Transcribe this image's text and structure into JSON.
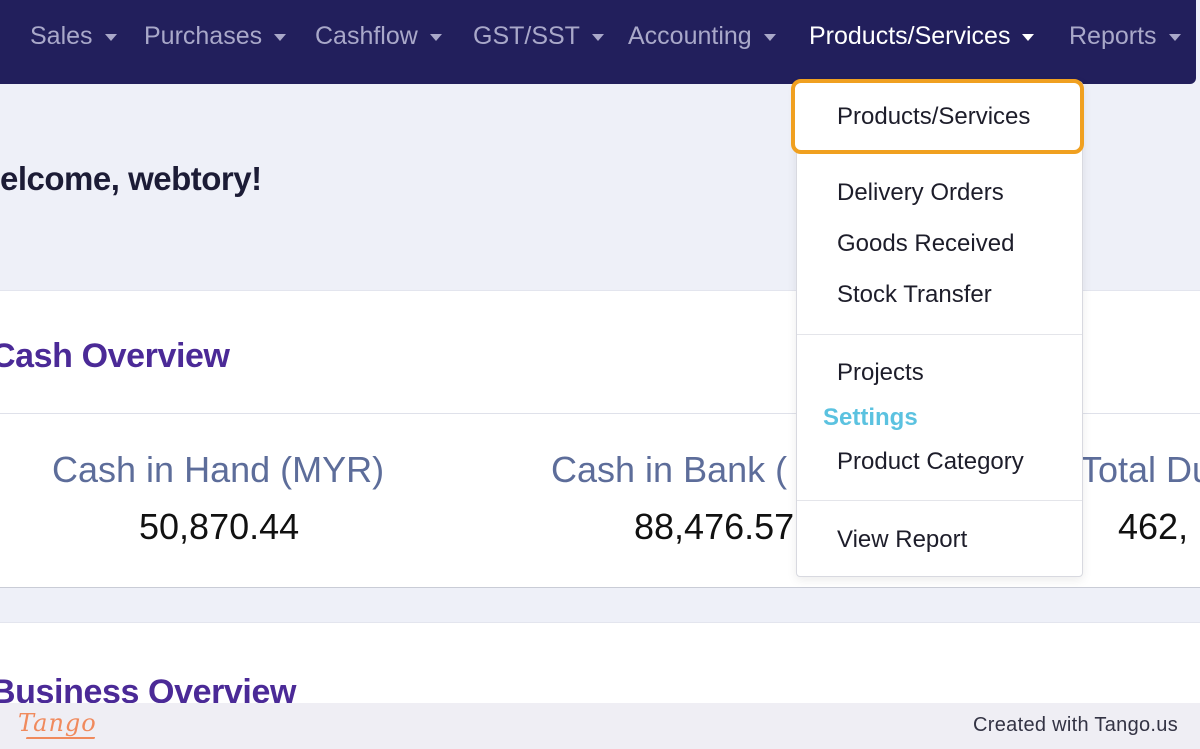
{
  "nav": {
    "items": [
      {
        "label": "Sales"
      },
      {
        "label": "Purchases"
      },
      {
        "label": "Cashflow"
      },
      {
        "label": "GST/SST"
      },
      {
        "label": "Accounting"
      },
      {
        "label": "Products/Services"
      },
      {
        "label": "Reports"
      }
    ],
    "active": "Products/Services"
  },
  "welcome": {
    "text": "elcome, webtory!"
  },
  "cash_overview": {
    "title": "Cash Overview",
    "metrics": [
      {
        "label": "Cash in Hand (MYR)",
        "value": "50,870.44"
      },
      {
        "label": "Cash in Bank (",
        "value": "88,476.57"
      },
      {
        "label": "Total Du",
        "value": "462,"
      }
    ]
  },
  "business_overview": {
    "title": "Business Overview"
  },
  "dropdown": {
    "highlighted": "Products/Services",
    "items": [
      {
        "label": "Delivery Orders"
      },
      {
        "label": "Goods Received"
      },
      {
        "label": "Stock Transfer"
      },
      {
        "label": "Projects"
      }
    ],
    "settings_header": "Settings",
    "settings_items": [
      {
        "label": "Product Category"
      }
    ],
    "report_item": "View Report"
  },
  "footer": {
    "logo": "Tango",
    "text": "Created with Tango.us"
  },
  "colors": {
    "navbar": "#221f5c",
    "highlight": "#f0a020",
    "title_purple": "#4b2a97",
    "settings_blue": "#5bc2e0"
  }
}
